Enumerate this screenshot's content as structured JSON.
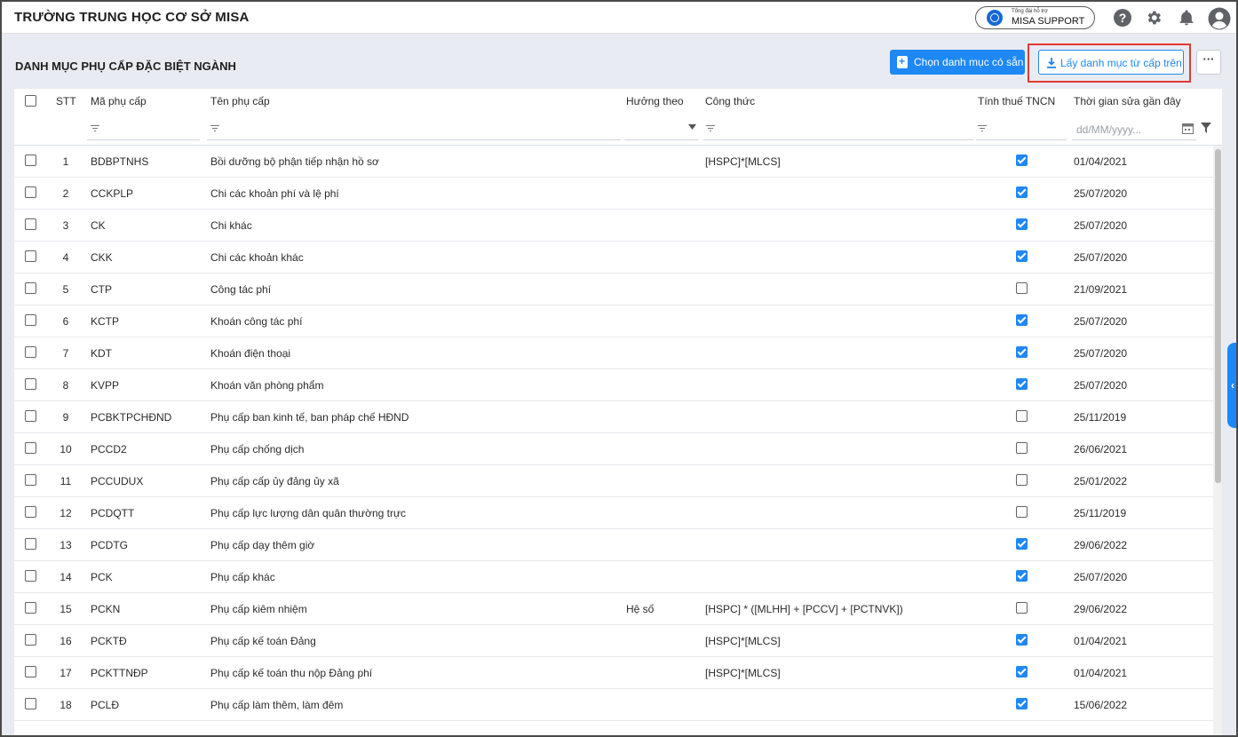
{
  "app": {
    "school_name": "TRƯỜNG TRUNG HỌC CƠ SỞ MISA",
    "support_small": "Tổng đài hỗ trợ",
    "support_label": "MISA SUPPORT",
    "help_glyph": "?"
  },
  "page": {
    "title": "DANH MỤC PHỤ CẤP ĐẶC BIỆT NGÀNH",
    "choose_button": "Chọn danh mục có sẵn",
    "get_button": "Lấy danh mục từ cấp trên",
    "more_button": "···",
    "accent_color": "#1e88f5",
    "highlight_color": "#e53935"
  },
  "table": {
    "columns": {
      "stt": "STT",
      "code": "Mã phụ cấp",
      "name": "Tên phụ cấp",
      "huong_theo": "Hưởng theo",
      "cong_thuc": "Công thức",
      "tax": "Tính thuế TNCN",
      "modified": "Thời gian sửa gần đây"
    },
    "date_placeholder": "dd/MM/yyyy...",
    "rows": [
      {
        "stt": "1",
        "code": "BDBPTNHS",
        "name": "Bồi dưỡng bộ phận tiếp nhận hồ sơ",
        "huong_theo": "",
        "cong_thuc": "[HSPC]*[MLCS]",
        "tax": true,
        "date": "01/04/2021"
      },
      {
        "stt": "2",
        "code": "CCKPLP",
        "name": "Chi các khoản phí và lệ phí",
        "huong_theo": "",
        "cong_thuc": "",
        "tax": true,
        "date": "25/07/2020"
      },
      {
        "stt": "3",
        "code": "CK",
        "name": "Chi khác",
        "huong_theo": "",
        "cong_thuc": "",
        "tax": true,
        "date": "25/07/2020"
      },
      {
        "stt": "4",
        "code": "CKK",
        "name": "Chi các khoản khác",
        "huong_theo": "",
        "cong_thuc": "",
        "tax": true,
        "date": "25/07/2020"
      },
      {
        "stt": "5",
        "code": "CTP",
        "name": "Công tác phí",
        "huong_theo": "",
        "cong_thuc": "",
        "tax": false,
        "date": "21/09/2021"
      },
      {
        "stt": "6",
        "code": "KCTP",
        "name": "Khoán công tác phí",
        "huong_theo": "",
        "cong_thuc": "",
        "tax": true,
        "date": "25/07/2020"
      },
      {
        "stt": "7",
        "code": "KDT",
        "name": "Khoán điện thoại",
        "huong_theo": "",
        "cong_thuc": "",
        "tax": true,
        "date": "25/07/2020"
      },
      {
        "stt": "8",
        "code": "KVPP",
        "name": "Khoán văn phòng phẩm",
        "huong_theo": "",
        "cong_thuc": "",
        "tax": true,
        "date": "25/07/2020"
      },
      {
        "stt": "9",
        "code": "PCBKTPCHĐND",
        "name": "Phụ cấp ban kinh tế, ban pháp chế HĐND",
        "huong_theo": "",
        "cong_thuc": "",
        "tax": false,
        "date": "25/11/2019"
      },
      {
        "stt": "10",
        "code": "PCCD2",
        "name": "Phụ cấp chống dịch",
        "huong_theo": "",
        "cong_thuc": "",
        "tax": false,
        "date": "26/06/2021"
      },
      {
        "stt": "11",
        "code": "PCCUDUX",
        "name": "Phụ cấp cấp ủy đảng ủy xã",
        "huong_theo": "",
        "cong_thuc": "",
        "tax": false,
        "date": "25/01/2022"
      },
      {
        "stt": "12",
        "code": "PCDQTT",
        "name": "Phụ cấp lực lượng dân quân thường trực",
        "huong_theo": "",
        "cong_thuc": "",
        "tax": false,
        "date": "25/11/2019"
      },
      {
        "stt": "13",
        "code": "PCDTG",
        "name": "Phụ cấp dạy thêm giờ",
        "huong_theo": "",
        "cong_thuc": "",
        "tax": true,
        "date": "29/06/2022"
      },
      {
        "stt": "14",
        "code": "PCK",
        "name": "Phụ cấp khác",
        "huong_theo": "",
        "cong_thuc": "",
        "tax": true,
        "date": "25/07/2020"
      },
      {
        "stt": "15",
        "code": "PCKN",
        "name": "Phụ cấp kiêm nhiệm",
        "huong_theo": "Hệ số",
        "cong_thuc": "[HSPC] * ([MLHH] + [PCCV] + [PCTNVK])",
        "tax": false,
        "date": "29/06/2022"
      },
      {
        "stt": "16",
        "code": "PCKTĐ",
        "name": "Phụ cấp kế toán Đảng",
        "huong_theo": "",
        "cong_thuc": "[HSPC]*[MLCS]",
        "tax": true,
        "date": "01/04/2021"
      },
      {
        "stt": "17",
        "code": "PCKTTNĐP",
        "name": "Phụ cấp kế toán thu nộp Đảng phí",
        "huong_theo": "",
        "cong_thuc": "[HSPC]*[MLCS]",
        "tax": true,
        "date": "01/04/2021"
      },
      {
        "stt": "18",
        "code": "PCLĐ",
        "name": "Phụ cấp làm thêm, làm đêm",
        "huong_theo": "",
        "cong_thuc": "",
        "tax": true,
        "date": "15/06/2022"
      }
    ]
  },
  "icons": {
    "help": "help-icon",
    "settings": "gear-icon",
    "notifications": "bell-icon",
    "user": "user-avatar-icon",
    "download": "download-icon",
    "filter": "filter-icon",
    "calendar": "calendar-icon",
    "collapse": "chevron-left-icon"
  }
}
